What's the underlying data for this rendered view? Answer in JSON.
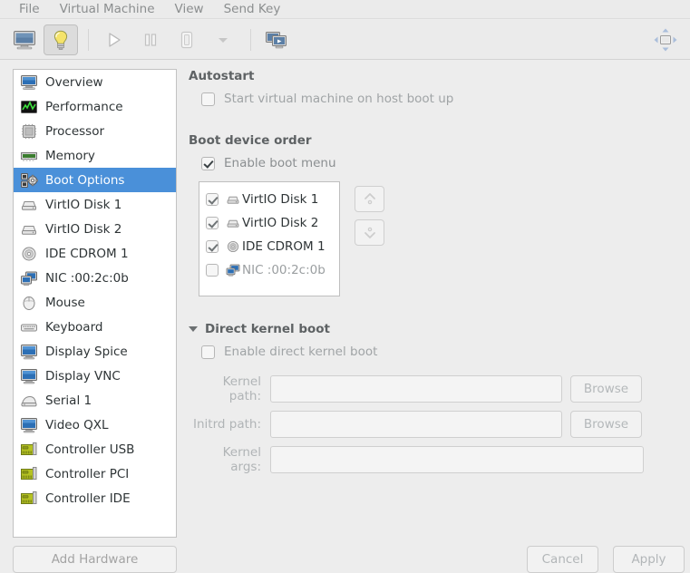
{
  "window": {
    "accent_color": "#4a90d9",
    "background_color": "#ededed",
    "panel_color": "#ffffff"
  },
  "menubar": {
    "items": [
      {
        "label": "File"
      },
      {
        "label": "Virtual Machine"
      },
      {
        "label": "View"
      },
      {
        "label": "Send Key"
      }
    ]
  },
  "toolbar": {
    "buttons": [
      {
        "name": "show-console-button",
        "icon": "monitor-icon",
        "active": false
      },
      {
        "name": "show-details-button",
        "icon": "lightbulb-icon",
        "active": true
      },
      {
        "name": "run-button",
        "icon": "play-icon",
        "active": false
      },
      {
        "name": "pause-button",
        "icon": "pause-icon",
        "active": false
      },
      {
        "name": "shutdown-button",
        "icon": "power-icon",
        "active": false
      },
      {
        "name": "shutdown-menu-button",
        "icon": "chevron-down-icon",
        "active": false
      },
      {
        "name": "snapshots-button",
        "icon": "screens-icon",
        "active": false
      }
    ],
    "right_button": {
      "name": "fullscreen-button",
      "icon": "fullscreen-icon"
    }
  },
  "sidebar": {
    "items": [
      {
        "label": "Overview",
        "icon": "computer-icon",
        "selected": false
      },
      {
        "label": "Performance",
        "icon": "graph-icon",
        "selected": false
      },
      {
        "label": "Processor",
        "icon": "cpu-icon",
        "selected": false
      },
      {
        "label": "Memory",
        "icon": "memory-icon",
        "selected": false
      },
      {
        "label": "Boot Options",
        "icon": "boot-gear-icon",
        "selected": true
      },
      {
        "label": "VirtIO Disk 1",
        "icon": "harddisk-icon",
        "selected": false
      },
      {
        "label": "VirtIO Disk 2",
        "icon": "harddisk-icon",
        "selected": false
      },
      {
        "label": "IDE CDROM 1",
        "icon": "cdrom-icon",
        "selected": false
      },
      {
        "label": "NIC :00:2c:0b",
        "icon": "network-icon",
        "selected": false
      },
      {
        "label": "Mouse",
        "icon": "mouse-icon",
        "selected": false
      },
      {
        "label": "Keyboard",
        "icon": "keyboard-icon",
        "selected": false
      },
      {
        "label": "Display Spice",
        "icon": "display-icon",
        "selected": false
      },
      {
        "label": "Display VNC",
        "icon": "display-icon",
        "selected": false
      },
      {
        "label": "Serial 1",
        "icon": "serial-icon",
        "selected": false
      },
      {
        "label": "Video QXL",
        "icon": "display-icon",
        "selected": false
      },
      {
        "label": "Controller USB",
        "icon": "controller-icon",
        "selected": false
      },
      {
        "label": "Controller PCI",
        "icon": "controller-icon",
        "selected": false
      },
      {
        "label": "Controller IDE",
        "icon": "controller-icon",
        "selected": false
      }
    ],
    "add_hardware_label": "Add Hardware"
  },
  "main": {
    "autostart": {
      "title": "Autostart",
      "checkbox_label": "Start virtual machine on host boot up",
      "checked": false
    },
    "boot_device_order": {
      "title": "Boot device order",
      "enable_boot_menu_label": "Enable boot menu",
      "enable_boot_menu_checked": true,
      "devices": [
        {
          "label": "VirtIO Disk 1",
          "icon": "harddisk-icon",
          "checked": true
        },
        {
          "label": "VirtIO Disk 2",
          "icon": "harddisk-icon",
          "checked": true
        },
        {
          "label": "IDE CDROM 1",
          "icon": "cdrom-icon",
          "checked": true
        },
        {
          "label": "NIC :00:2c:0b",
          "icon": "network-icon",
          "checked": false
        }
      ],
      "move_up_button": "move-up-button",
      "move_down_button": "move-down-button"
    },
    "direct_kernel_boot": {
      "title": "Direct kernel boot",
      "expanded": true,
      "checkbox_label": "Enable direct kernel boot",
      "checked": false,
      "fields": [
        {
          "label": "Kernel path:",
          "value": "",
          "browse_label": "Browse",
          "has_browse": true
        },
        {
          "label": "Initrd path:",
          "value": "",
          "browse_label": "Browse",
          "has_browse": true
        },
        {
          "label": "Kernel args:",
          "value": "",
          "browse_label": "",
          "has_browse": false
        }
      ]
    }
  },
  "footer": {
    "cancel_label": "Cancel",
    "apply_label": "Apply"
  }
}
